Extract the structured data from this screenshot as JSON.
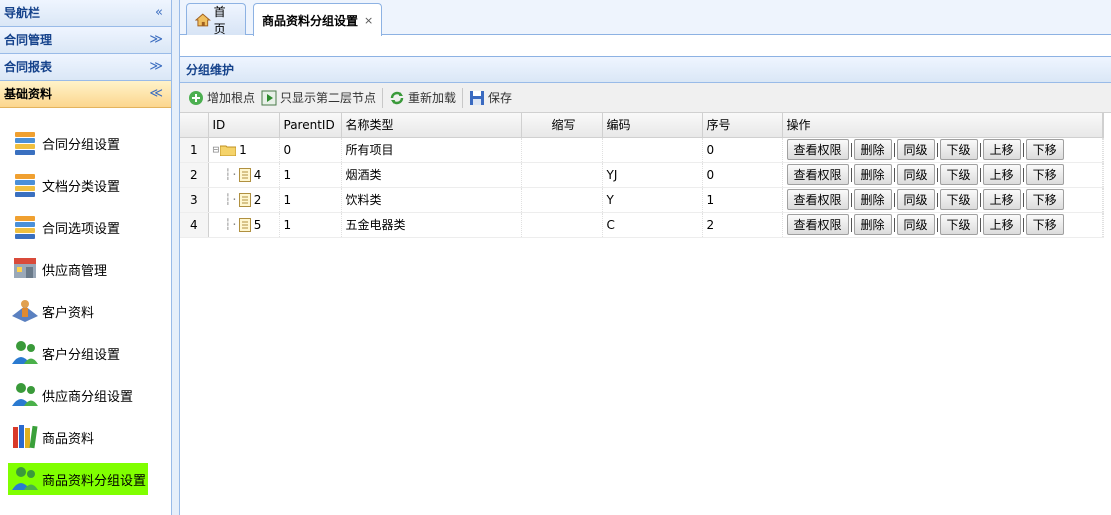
{
  "sidebar": {
    "sections": [
      {
        "label": "导航栏",
        "tool": "«"
      },
      {
        "label": "合同管理",
        "tool": "≫"
      },
      {
        "label": "合同报表",
        "tool": "≫"
      },
      {
        "label": "基础资料",
        "tool": "≪"
      }
    ],
    "items": [
      {
        "label": "合同分组设置",
        "icon": "stack-icon"
      },
      {
        "label": "文档分类设置",
        "icon": "stack-icon"
      },
      {
        "label": "合同选项设置",
        "icon": "stack-icon"
      },
      {
        "label": "供应商管理",
        "icon": "supplier-icon"
      },
      {
        "label": "客户资料",
        "icon": "client-icon"
      },
      {
        "label": "客户分组设置",
        "icon": "users-icon"
      },
      {
        "label": "供应商分组设置",
        "icon": "users-icon"
      },
      {
        "label": "商品资料",
        "icon": "books-icon"
      },
      {
        "label": "商品资料分组设置",
        "icon": "users-icon"
      }
    ]
  },
  "tabs": [
    {
      "label": "首页"
    },
    {
      "label": "商品资料分组设置",
      "close": "×"
    }
  ],
  "panel": {
    "title": "分组维护"
  },
  "toolbar": {
    "add_root": "增加根点",
    "show_second_level": "只显示第二层节点",
    "reload": "重新加载",
    "save": "保存"
  },
  "grid": {
    "headers": [
      "ID",
      "ParentID",
      "名称类型",
      "缩写",
      "编码",
      "序号",
      "操作"
    ],
    "rows": [
      {
        "rownum": "1",
        "id": "1",
        "parent": "0",
        "name": "所有项目",
        "abbr": "",
        "code": "",
        "order": "0",
        "kind": "folder"
      },
      {
        "rownum": "2",
        "id": "4",
        "parent": "1",
        "name": "烟酒类",
        "abbr": "",
        "code": "YJ",
        "order": "0",
        "kind": "leaf"
      },
      {
        "rownum": "3",
        "id": "2",
        "parent": "1",
        "name": "饮料类",
        "abbr": "",
        "code": "Y",
        "order": "1",
        "kind": "leaf"
      },
      {
        "rownum": "4",
        "id": "5",
        "parent": "1",
        "name": "五金电器类",
        "abbr": "",
        "code": "C",
        "order": "2",
        "kind": "leaf"
      }
    ],
    "actions": [
      "查看权限",
      "删除",
      "同级",
      "下级",
      "上移",
      "下移"
    ]
  },
  "colors": {
    "selected_menu": "#80ff00",
    "header_blue": "#15428b"
  }
}
